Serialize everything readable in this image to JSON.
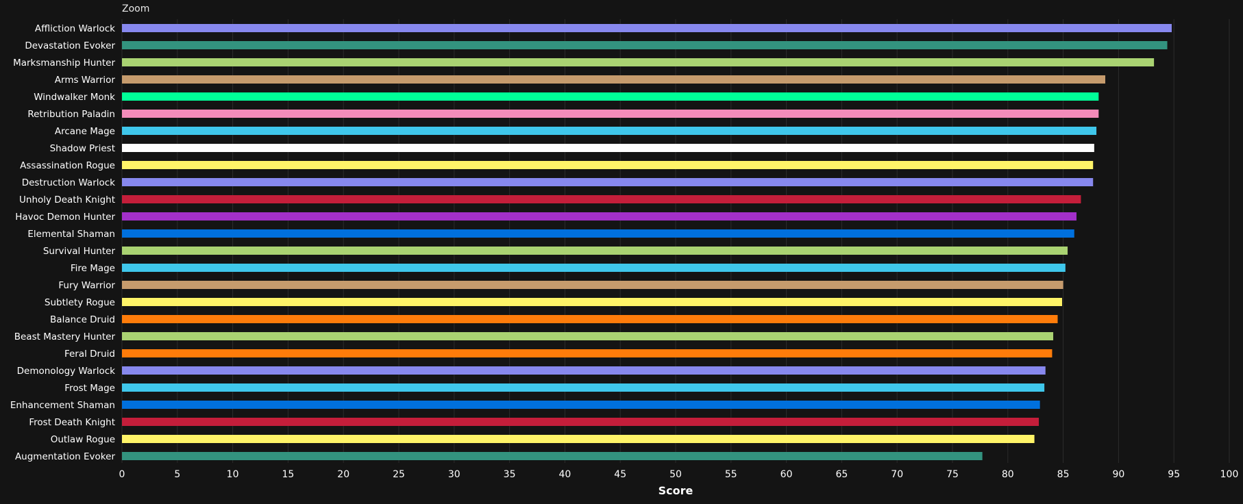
{
  "toolbar": {
    "zoom_label": "Zoom"
  },
  "chart_data": {
    "type": "bar",
    "orientation": "horizontal",
    "title": "",
    "xlabel": "Score",
    "ylabel": "",
    "xlim": [
      0,
      100
    ],
    "x_ticks": [
      0,
      5,
      10,
      15,
      20,
      25,
      30,
      35,
      40,
      45,
      50,
      55,
      60,
      65,
      70,
      75,
      80,
      85,
      90,
      95,
      100
    ],
    "grid": "vertical",
    "background_color": "#141414",
    "gridline_color": "#2c2c2c",
    "categories": [
      "Affliction Warlock",
      "Devastation Evoker",
      "Marksmanship Hunter",
      "Arms Warrior",
      "Windwalker Monk",
      "Retribution Paladin",
      "Arcane Mage",
      "Shadow Priest",
      "Assassination Rogue",
      "Destruction Warlock",
      "Unholy Death Knight",
      "Havoc Demon Hunter",
      "Elemental Shaman",
      "Survival Hunter",
      "Fire Mage",
      "Fury Warrior",
      "Subtlety Rogue",
      "Balance Druid",
      "Beast Mastery Hunter",
      "Feral Druid",
      "Demonology Warlock",
      "Frost Mage",
      "Enhancement Shaman",
      "Frost Death Knight",
      "Outlaw Rogue",
      "Augmentation Evoker"
    ],
    "values": [
      94.8,
      94.4,
      93.2,
      88.8,
      88.2,
      88.2,
      88.0,
      87.8,
      87.7,
      87.7,
      86.6,
      86.2,
      86.0,
      85.4,
      85.2,
      85.0,
      84.9,
      84.5,
      84.1,
      84.0,
      83.4,
      83.3,
      82.9,
      82.8,
      82.4,
      77.7
    ],
    "colors": [
      "#8788ee",
      "#33937f",
      "#aad372",
      "#c69b6d",
      "#00ff98",
      "#f48cba",
      "#3fc7eb",
      "#ffffff",
      "#fff468",
      "#8788ee",
      "#c41e3a",
      "#a330c9",
      "#0070dd",
      "#aad372",
      "#3fc7eb",
      "#c69b6d",
      "#fff468",
      "#ff7c0a",
      "#aad372",
      "#ff7c0a",
      "#8788ee",
      "#3fc7eb",
      "#0070dd",
      "#c41e3a",
      "#fff468",
      "#33937f"
    ]
  }
}
